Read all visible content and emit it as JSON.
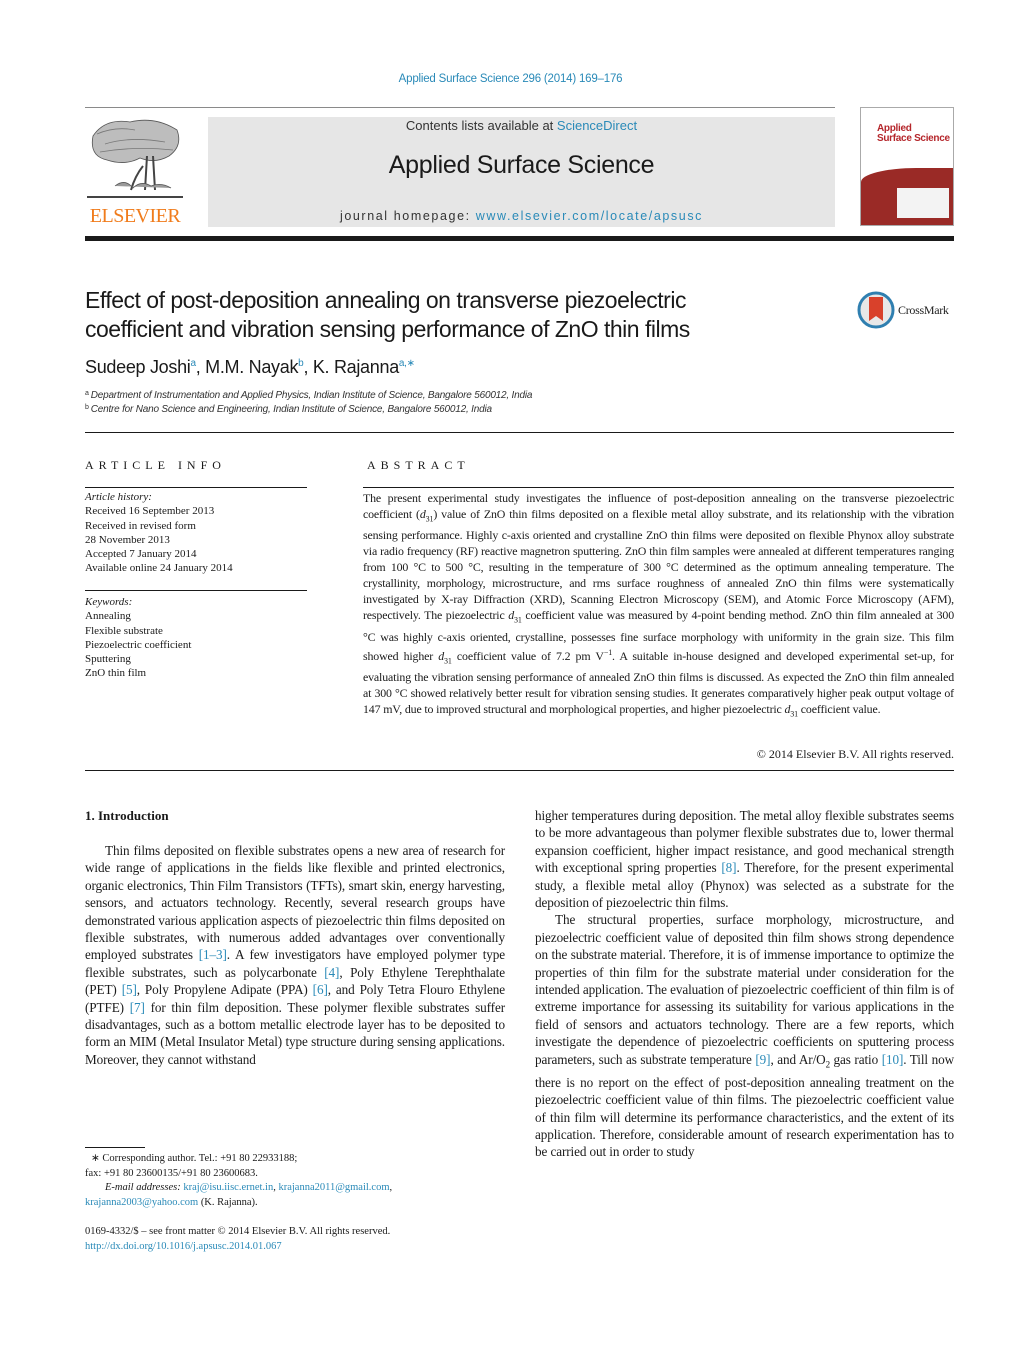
{
  "header": {
    "citation": "Applied Surface Science 296 (2014) 169–176",
    "contents_prefix": "Contents lists available at ",
    "contents_link": "ScienceDirect",
    "journal_name": "Applied Surface Science",
    "homepage_prefix": "journal homepage: ",
    "homepage_link": "www.elsevier.com/locate/apsusc",
    "publisher_logo_text": "ELSEVIER",
    "cover_title_line1": "Applied",
    "cover_title_line2": "Surface Science",
    "icons": {
      "publisher_logo": "elsevier-tree-logo",
      "cover": "journal-cover-thumbnail"
    },
    "colors": {
      "link": "#2a8ab8",
      "elsevier_orange": "#f07c1c",
      "cover_red": "#9a2a26",
      "banner_bg": "#e6e6e6"
    }
  },
  "article": {
    "title_line1": "Effect of post-deposition annealing on transverse piezoelectric",
    "title_line2": "coefficient and vibration sensing performance of ZnO thin films",
    "crossmark_label": "CrossMark",
    "authors": [
      {
        "name": "Sudeep Joshi",
        "sup": "a"
      },
      {
        "name": "M.M. Nayak",
        "sup": "b"
      },
      {
        "name": "K. Rajanna",
        "sup": "a,∗"
      }
    ],
    "author_separator": ", ",
    "affiliations": [
      {
        "key": "a",
        "text": "Department of Instrumentation and Applied Physics, Indian Institute of Science, Bangalore 560012, India"
      },
      {
        "key": "b",
        "text": "Centre for Nano Science and Engineering, Indian Institute of Science, Bangalore 560012, India"
      }
    ]
  },
  "article_info": {
    "heading": "ARTICLE INFO",
    "history_label": "Article history:",
    "history": [
      "Received 16 September 2013",
      "Received in revised form",
      "28 November 2013",
      "Accepted 7 January 2014",
      "Available online 24 January 2014"
    ],
    "keywords_label": "Keywords:",
    "keywords": [
      "Annealing",
      "Flexible substrate",
      "Piezoelectric coefficient",
      "Sputtering",
      "ZnO thin film"
    ]
  },
  "abstract": {
    "heading": "ABSTRACT",
    "parts": {
      "p1": "The present experimental study investigates the influence of post-deposition annealing on the transverse piezoelectric coefficient (",
      "d31": "d",
      "sub31": "31",
      "p2": ") value of ZnO thin films deposited on a flexible metal alloy substrate, and its relationship with the vibration sensing performance. Highly c-axis oriented and crystalline ZnO thin films were deposited on flexible Phynox alloy substrate via radio frequency (RF) reactive magnetron sputtering. ZnO thin film samples were annealed at different temperatures ranging from 100 °C to 500 °C, resulting in the temperature of 300 °C determined as the optimum annealing temperature. The crystallinity, morphology, microstructure, and rms surface roughness of annealed ZnO thin films were systematically investigated by X-ray Diffraction (XRD), Scanning Electron Microscopy (SEM), and Atomic Force Microscopy (AFM), respectively. The piezoelectric ",
      "p3": " coefficient value was measured by 4-point bending method. ZnO thin film annealed at 300 °C was highly c-axis oriented, crystalline, possesses fine surface morphology with uniformity in the grain size. This film showed higher ",
      "p4": " coefficient value of 7.2 pm V",
      "sup_minus1": "−1",
      "p5": ". A suitable in-house designed and developed experimental set-up, for evaluating the vibration sensing performance of annealed ZnO thin films is discussed. As expected the ZnO thin film annealed at 300 °C showed relatively better result for vibration sensing studies. It generates comparatively higher peak output voltage of 147 mV, due to improved structural and morphological properties, and higher piezoelectric ",
      "p6": " coefficient value."
    },
    "copyright": "© 2014 Elsevier B.V. All rights reserved."
  },
  "body": {
    "section_heading": "1.  Introduction",
    "left": {
      "para1_a": "Thin films deposited on flexible substrates opens a new area of research for wide range of applications in the fields like flexible and printed electronics, organic electronics, Thin Film Transistors (TFTs), smart skin, energy harvesting, sensors, and actuators technology. Recently, several research groups have demonstrated various application aspects of piezoelectric thin films deposited on flexible substrates, with numerous added advantages over conventionally employed substrates ",
      "ref_1_3": "[1–3]",
      "para1_b": ". A few investigators have employed polymer type flexible substrates, such as polycarbonate ",
      "ref_4": "[4]",
      "para1_c": ", Poly Ethylene Terephthalate (PET) ",
      "ref_5": "[5]",
      "para1_d": ", Poly Propylene Adipate (PPA) ",
      "ref_6": "[6]",
      "para1_e": ", and Poly Tetra Flouro Ethylene (PTFE) ",
      "ref_7": "[7]",
      "para1_f": " for thin film deposition. These polymer flexible substrates suffer disadvantages, such as a bottom metallic electrode layer has to be deposited to form an MIM (Metal Insulator Metal) type structure during sensing applications. Moreover, they cannot withstand"
    },
    "right": {
      "para1_a": "higher temperatures during deposition. The metal alloy flexible substrates seems to be more advantageous than polymer flexible substrates due to, lower thermal expansion coefficient, higher impact resistance, and good mechanical strength with exceptional spring properties ",
      "ref_8": "[8]",
      "para1_b": ". Therefore, for the present experimental study, a flexible metal alloy (Phynox) was selected as a substrate for the deposition of piezoelectric thin films.",
      "para2_a": "The structural properties, surface morphology, microstructure, and piezoelectric coefficient value of deposited thin film shows strong dependence on the substrate material. Therefore, it is of immense importance to optimize the properties of thin film for the substrate material under consideration for the intended application. The evaluation of piezoelectric coefficient of thin film is of extreme importance for assessing its suitability for various applications in the field of sensors and actuators technology. There are a few reports, which investigate the dependence of piezoelectric coefficients on sputtering process parameters, such as substrate temperature ",
      "ref_9": "[9]",
      "para2_b": ", and Ar/O",
      "sub2": "2",
      "para2_c": " gas ratio ",
      "ref_10": "[10]",
      "para2_d": ". Till now there is no report on the effect of post-deposition annealing treatment on the piezoelectric coefficient value of thin films. The piezoelectric coefficient value of thin film will determine its performance characteristics, and the extent of its application. Therefore, considerable amount of research experimentation has to be carried out in order to study"
    }
  },
  "footnotes": {
    "corresponding": "∗  Corresponding author. Tel.: +91 80 22933188;",
    "fax": "fax: +91 80 23600135/+91 80 23600683.",
    "email_label": "E-mail addresses:",
    "email1": "kraj@isu.iisc.ernet.in",
    "email2": "krajanna2011@gmail.com",
    "email3": "krajanna2003@yahoo.com",
    "email_owner": " (K. Rajanna).",
    "front_matter": "0169-4332/$ – see front matter © 2014 Elsevier B.V. All rights reserved.",
    "doi": "http://dx.doi.org/10.1016/j.apsusc.2014.01.067"
  }
}
